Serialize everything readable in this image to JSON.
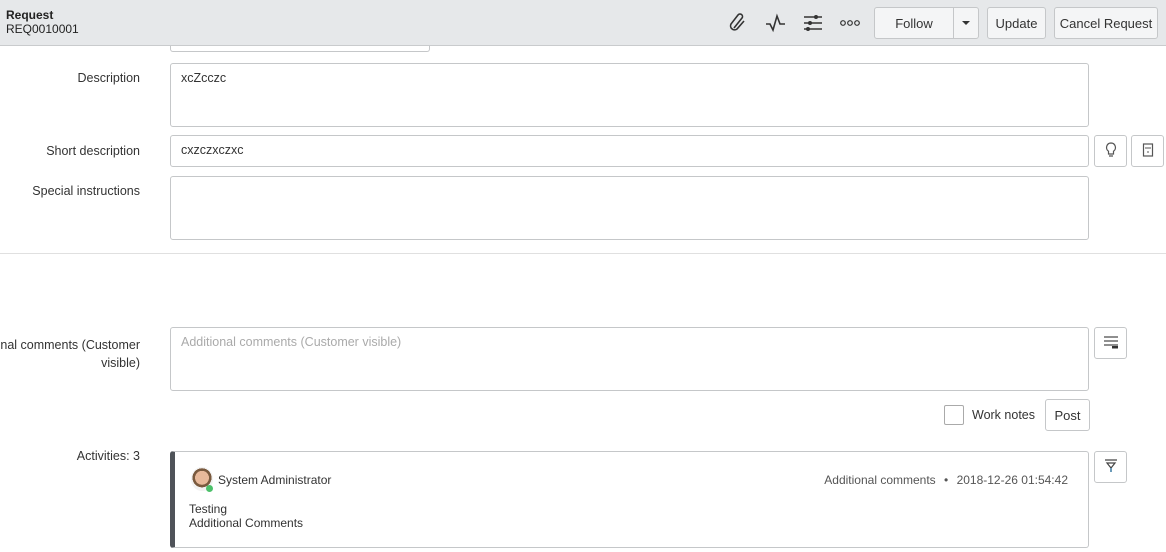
{
  "header": {
    "title": "Request",
    "number": "REQ0010001",
    "follow": "Follow",
    "update": "Update",
    "cancel": "Cancel Request"
  },
  "form": {
    "description_label": "Description",
    "description_value": "xcZcczc",
    "short_label": "Short description",
    "short_value": "cxzczxczxc",
    "special_label": "Special instructions",
    "comments_label_1": "onal comments (Customer",
    "comments_label_2": "visible)",
    "comments_placeholder": "Additional comments (Customer visible)",
    "work_notes": "Work notes",
    "post": "Post"
  },
  "activities": {
    "label": "Activities: 3",
    "entries": [
      {
        "user": "System Administrator",
        "type": "Additional comments",
        "timestamp": "2018-12-26 01:54:42",
        "lines": [
          "Testing",
          "Additional Comments"
        ]
      }
    ]
  }
}
